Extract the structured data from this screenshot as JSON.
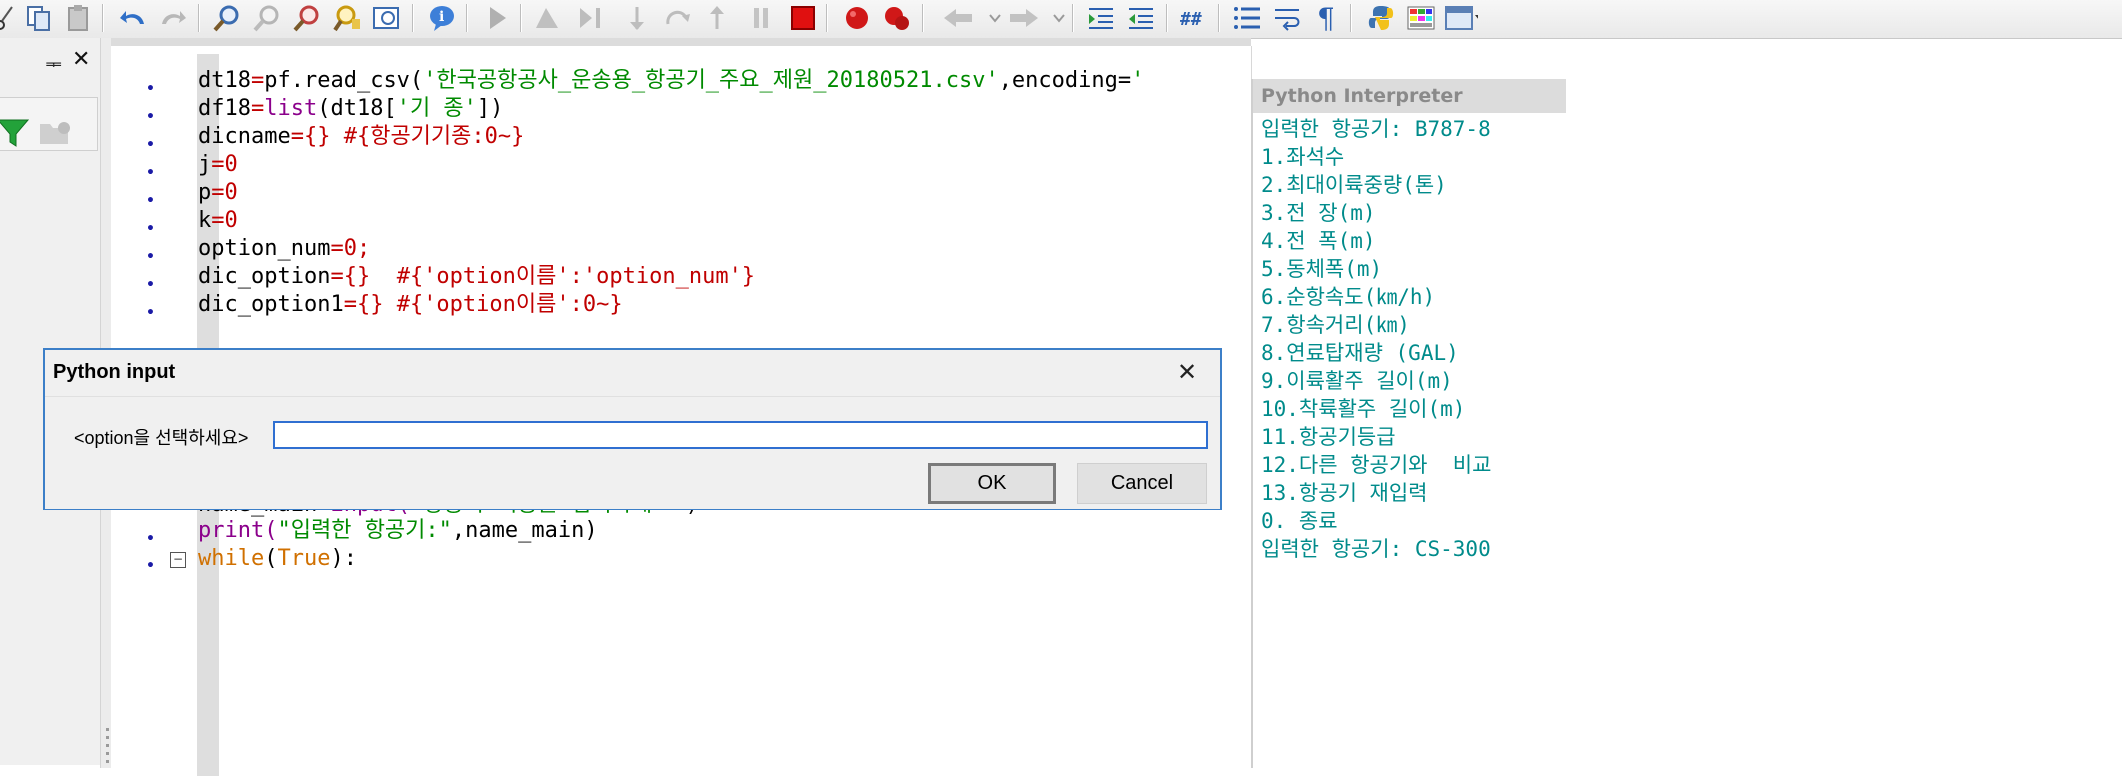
{
  "toolbar": {
    "icons": [
      "cut-icon",
      "copy-icon",
      "paste-icon",
      "undo-icon",
      "redo-icon",
      "find-icon",
      "find-next-icon",
      "find-replace-icon",
      "find-in-files-icon",
      "image-browser-icon",
      "info-icon",
      "run-icon",
      "debug-icon",
      "step-icon",
      "step-over-icon",
      "step-out-icon",
      "pause-icon",
      "stop-icon",
      "breakpoint-icon",
      "clear-breakpoints-icon",
      "back-icon",
      "forward-icon",
      "indent-icon",
      "dedent-icon",
      "comment-icon",
      "bullets-icon",
      "wrap-icon",
      "pilcrow-icon",
      "python-icon",
      "color-grid-icon",
      "layout-icon"
    ]
  },
  "left_panel": {
    "pin_glyph": "ᆍ",
    "close_glyph": "✕"
  },
  "editor": {
    "lines": [
      {
        "parts": [
          [
            "dt18",
            ""
          ],
          [
            "=",
            "op"
          ],
          [
            "pf.read_csv(",
            ""
          ],
          [
            "'한국공항공사_운송용_항공기_주요_제원_20180521.csv'",
            "str"
          ],
          [
            ",encoding=",
            ""
          ],
          [
            "'",
            "str"
          ]
        ]
      },
      {
        "parts": [
          [
            "df18",
            ""
          ],
          [
            "=",
            "op"
          ],
          [
            "list",
            "bi"
          ],
          [
            "(dt18[",
            ""
          ],
          [
            "'기 종'",
            "str"
          ],
          [
            "])",
            ""
          ]
        ]
      },
      {
        "parts": [
          [
            "dicname",
            ""
          ],
          [
            "={}",
            "op"
          ],
          [
            " #{항공기기종:0~}",
            "cmt"
          ]
        ]
      },
      {
        "parts": [
          [
            "j",
            ""
          ],
          [
            "=0",
            "op"
          ]
        ]
      },
      {
        "parts": [
          [
            "p",
            ""
          ],
          [
            "=0",
            "op"
          ]
        ]
      },
      {
        "parts": [
          [
            "k",
            ""
          ],
          [
            "=0",
            "op"
          ]
        ]
      },
      {
        "parts": [
          [
            "option_num",
            ""
          ],
          [
            "=0;",
            "op"
          ]
        ]
      },
      {
        "parts": [
          [
            "dic_option",
            ""
          ],
          [
            "={}",
            "op"
          ],
          [
            "  #{'option이름':'option_num'}",
            "cmt"
          ]
        ]
      },
      {
        "parts": [
          [
            "dic_option1",
            ""
          ],
          [
            "={}",
            "op"
          ],
          [
            " #{'option이름':0~}",
            "cmt"
          ]
        ]
      },
      {
        "parts": [
          [
            "name_main",
            ""
          ],
          [
            "=",
            "op"
          ],
          [
            "input(",
            "bi"
          ],
          [
            "'항공기 기종을 입력하세요'",
            "str"
          ],
          [
            ")",
            ""
          ]
        ]
      },
      {
        "parts": [
          [
            "print(",
            "bi"
          ],
          [
            "\"입력한 항공기:\"",
            "str"
          ],
          [
            ",name_main)",
            ""
          ]
        ]
      },
      {
        "parts": [
          [
            "while",
            "kw"
          ],
          [
            "(",
            ""
          ],
          [
            "True",
            "kw"
          ],
          [
            "):",
            ""
          ]
        ]
      }
    ]
  },
  "interpreter": {
    "title": "Python Interpreter",
    "lines": [
      "입력한 항공기: B787-8",
      "1.좌석수",
      "2.최대이륙중량(톤)",
      "3.전 장(m)",
      "4.전 폭(m)",
      "5.동체폭(m)",
      "6.순항속도(㎞/h)",
      "7.항속거리(㎞)",
      "8.연료탑재량 (GAL)",
      "9.이륙활주 길이(m)",
      "10.착륙활주 길이(m)",
      "11.항공기등급",
      "12.다른 항공기와  비교",
      "13.항공기 재입력",
      "0. 종료",
      "입력한 항공기: CS-300"
    ]
  },
  "dialog": {
    "title": "Python input",
    "close_glyph": "✕",
    "prompt": "<option을 선택하세요>",
    "input_value": "",
    "ok_label": "OK",
    "cancel_label": "Cancel"
  },
  "colors": {
    "accent_border": "#3c7fc8",
    "output_text": "#008b8b",
    "string": "#008a00",
    "operator": "#c00000"
  }
}
